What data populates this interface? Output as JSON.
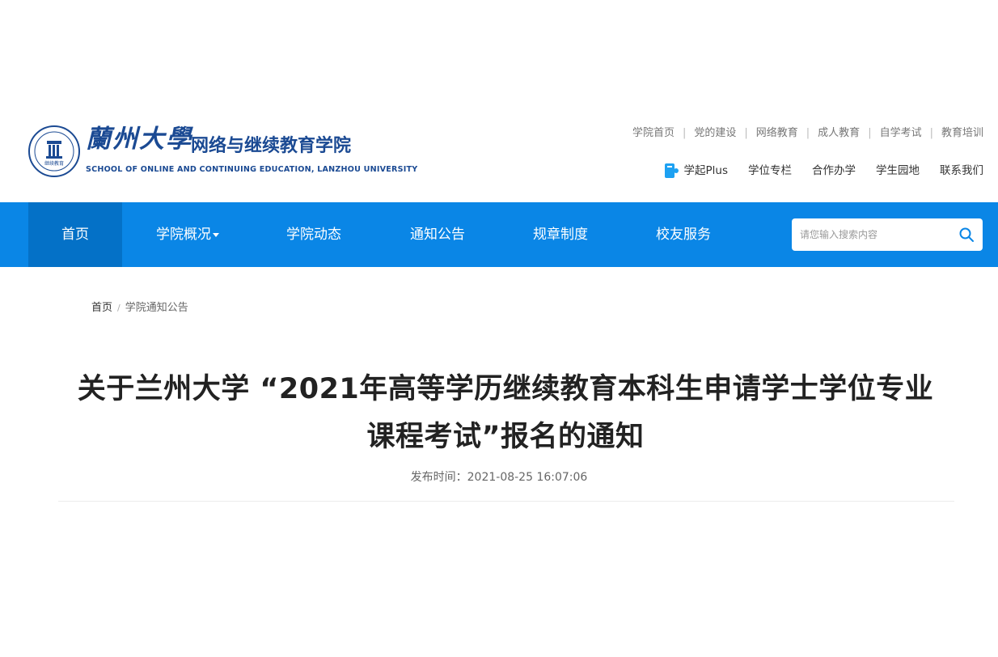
{
  "header": {
    "logo": {
      "univ_cn": "蘭州大學",
      "school_cn": "网络与继续教育学院",
      "school_en": "SCHOOL OF ONLINE AND CONTINUING EDUCATION, LANZHOU UNIVERSITY",
      "seal_text": "继续教育"
    },
    "top_links": [
      "学院首页",
      "党的建设",
      "网络教育",
      "成人教育",
      "自学考试",
      "教育培训"
    ],
    "sub_links": [
      "学起Plus",
      "学位专栏",
      "合作办学",
      "学生园地",
      "联系我们"
    ],
    "brand_colors": {
      "primary": "#1b4a93",
      "nav": "#0a86e6",
      "nav_active": "#0471c7"
    }
  },
  "nav": {
    "items": [
      {
        "label": "首页",
        "active": true
      },
      {
        "label": "学院概况",
        "dropdown": true
      },
      {
        "label": "学院动态"
      },
      {
        "label": "通知公告"
      },
      {
        "label": "规章制度"
      },
      {
        "label": "校友服务"
      }
    ],
    "search": {
      "placeholder": "请您输入搜索内容",
      "value": ""
    }
  },
  "breadcrumb": {
    "home": "首页",
    "current": "学院通知公告"
  },
  "article": {
    "title": "关于兰州大学 “2021年高等学历继续教育本科生申请学士学位专业课程考试”报名的通知",
    "meta": "发布时间：2021-08-25 16:07:06"
  }
}
